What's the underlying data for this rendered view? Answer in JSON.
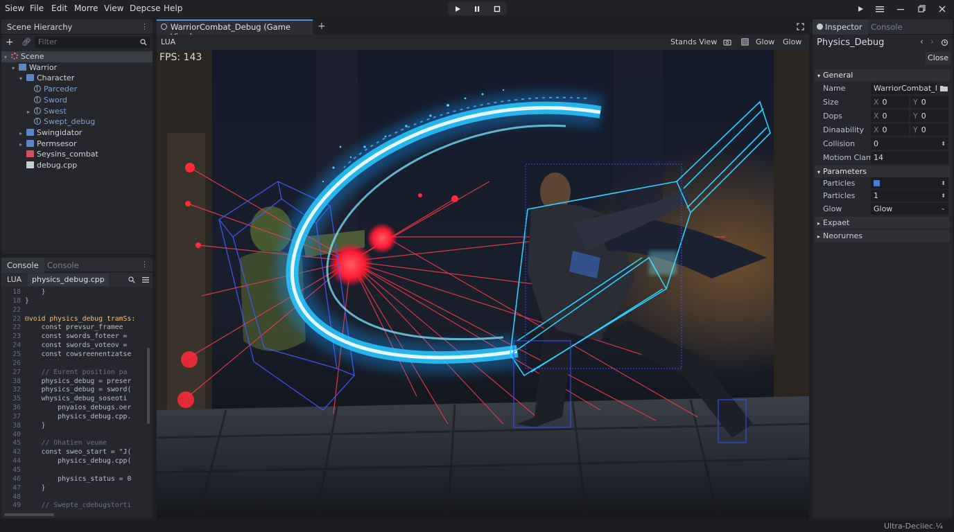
{
  "menu": [
    "Siew",
    "File",
    "Edit",
    "Morre",
    "View",
    "Depcse",
    "Help"
  ],
  "hierarchy": {
    "title": "Scene Hierarchy",
    "filter_placeholder": "Filter",
    "items": [
      {
        "label": "Scene",
        "kind": "scene",
        "depth": 0,
        "arrow": "▾",
        "selected": true
      },
      {
        "label": "Warrior",
        "kind": "folder",
        "depth": 1,
        "arrow": "▾"
      },
      {
        "label": "Character",
        "kind": "folder",
        "depth": 2,
        "arrow": "▾"
      },
      {
        "label": "Parceder",
        "kind": "node",
        "depth": 3,
        "arrow": ""
      },
      {
        "label": "Sword",
        "kind": "node",
        "depth": 3,
        "arrow": ""
      },
      {
        "label": "Swest",
        "kind": "node",
        "depth": 3,
        "arrow": "▸"
      },
      {
        "label": "Swept_debug",
        "kind": "node",
        "depth": 3,
        "arrow": ""
      },
      {
        "label": "Swingidator",
        "kind": "folder",
        "depth": 2,
        "arrow": "▸"
      },
      {
        "label": "Permsesor",
        "kind": "folder",
        "depth": 2,
        "arrow": "▸"
      },
      {
        "label": "Seysins_combat",
        "kind": "script",
        "depth": 2,
        "arrow": ""
      },
      {
        "label": "debug.cpp",
        "kind": "file",
        "depth": 2,
        "arrow": ""
      }
    ]
  },
  "console_panel": {
    "tab_active": "Console",
    "tab_inactive": "Console",
    "lang": "LUA",
    "file": "physics_debug.cpp",
    "lines": [
      {
        "n": "18",
        "t": "    }",
        "c": ""
      },
      {
        "n": "18",
        "t": "}",
        "c": ""
      },
      {
        "n": "22",
        "t": "",
        "c": ""
      },
      {
        "n": "22",
        "t": "⊟void physics_debug tramSs:",
        "c": "fn"
      },
      {
        "n": "22",
        "t": "    const prevsur_framee",
        "c": ""
      },
      {
        "n": "23",
        "t": "    const swords_foteer =",
        "c": ""
      },
      {
        "n": "24",
        "t": "    const swords_voteov =",
        "c": ""
      },
      {
        "n": "25",
        "t": "    const cowsreenentzatse",
        "c": ""
      },
      {
        "n": "26",
        "t": "",
        "c": ""
      },
      {
        "n": "27",
        "t": "    // Eurent position pa",
        "c": "cm"
      },
      {
        "n": "38",
        "t": "    physics_debug = preser",
        "c": ""
      },
      {
        "n": "32",
        "t": "    physics_debug = sword(",
        "c": ""
      },
      {
        "n": "35",
        "t": "    whysics_debug_soseoti",
        "c": ""
      },
      {
        "n": "36",
        "t": "        pnyaios_debugs.oer",
        "c": ""
      },
      {
        "n": "37",
        "t": "        physics_debug.cpp.",
        "c": ""
      },
      {
        "n": "38",
        "t": "    }",
        "c": ""
      },
      {
        "n": "40",
        "t": "",
        "c": ""
      },
      {
        "n": "45",
        "t": "    // Ohatien veume",
        "c": "cm"
      },
      {
        "n": "42",
        "t": "    const sweo_start = \"J(",
        "c": ""
      },
      {
        "n": "44",
        "t": "        physics_debug.cpp(",
        "c": ""
      },
      {
        "n": "45",
        "t": "",
        "c": ""
      },
      {
        "n": "46",
        "t": "        physics_status = 0",
        "c": ""
      },
      {
        "n": "47",
        "t": "    }",
        "c": ""
      },
      {
        "n": "48",
        "t": "",
        "c": ""
      },
      {
        "n": "49",
        "t": "    // Swepte_cdebugstorti",
        "c": "cm"
      }
    ]
  },
  "viewport_tab": {
    "title": "WarriorCombat_Debug (Game View)",
    "lang": "LUA",
    "stands_view": "Stands View",
    "glow1": "Glow",
    "glow2": "Glow",
    "fps": "FPS: 143"
  },
  "inspector": {
    "tab_active": "Inspector",
    "tab_inactive": "Console",
    "node_title": "Physics_Debug",
    "close_label": "Close",
    "general_label": "General",
    "parameters_label": "Parameters",
    "expaet_label": "Expaet",
    "neorurnes_label": "Neorurnes",
    "name_label": "Name",
    "name_value": "WarriorCombat_I",
    "size_label": "Size",
    "size_x": "0",
    "size_y": "0",
    "dops_label": "Dops",
    "dops_x": "0",
    "dops_y": "0",
    "dinaability_label": "Dinaability",
    "dina_x": "0",
    "dina_y": "0",
    "collision_label": "Collision",
    "collision_value": "0",
    "motion_label": "Motiom Clam",
    "motion_value": "14",
    "particles1_label": "Particles",
    "particles2_label": "Particles",
    "particles2_value": "1",
    "glow_label": "Glow",
    "glow_value": "Glow",
    "axis_x": "X",
    "axis_y": "Y"
  },
  "statusbar": {
    "text": "Ultra-Deciiec.¼"
  },
  "colors": {
    "accent": "#4a90e2",
    "panel": "#25272c",
    "bg": "#1e1f23",
    "sweep": "#27c4ff",
    "debug_red": "#ff2a3a"
  }
}
